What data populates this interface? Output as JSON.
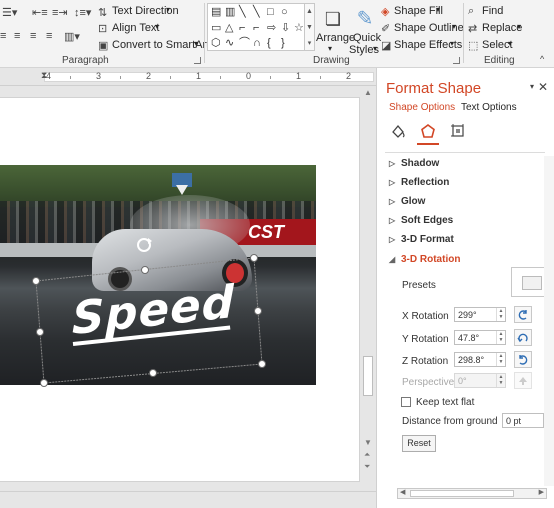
{
  "ribbon": {
    "text_direction": "Text Direction",
    "align_text": "Align Text",
    "convert_smartart": "Convert to SmartArt",
    "arrange": "Arrange",
    "quick_styles_1": "Quick",
    "quick_styles_2": "Styles",
    "shape_fill": "Shape Fill",
    "shape_outline": "Shape Outline",
    "shape_effects": "Shape Effects",
    "find": "Find",
    "replace": "Replace",
    "select": "Select",
    "groups": {
      "paragraph": "Paragraph",
      "drawing": "Drawing",
      "editing": "Editing"
    }
  },
  "ruler": {
    "numbers": [
      "4",
      "3",
      "2",
      "1",
      "0",
      "1",
      "2"
    ]
  },
  "slide": {
    "text": "Speed",
    "banner": "CST"
  },
  "pane": {
    "title": "Format Shape",
    "tabs": {
      "shape_options": "Shape Options",
      "text_options": "Text Options"
    },
    "sections": [
      "Shadow",
      "Reflection",
      "Glow",
      "Soft Edges",
      "3-D Format"
    ],
    "open_section": "3-D Rotation",
    "presets_label": "Presets",
    "rotations": [
      {
        "label": "X Rotation",
        "value": "299°"
      },
      {
        "label": "Y Rotation",
        "value": "47.8°"
      },
      {
        "label": "Z Rotation",
        "value": "298.8°"
      }
    ],
    "perspective": {
      "label": "Perspective",
      "value": "0°"
    },
    "keep_text_flat": "Keep text flat",
    "distance": {
      "label": "Distance from ground",
      "value": "0 pt"
    },
    "reset": "Reset"
  },
  "colors": {
    "accent": "#d24726"
  }
}
